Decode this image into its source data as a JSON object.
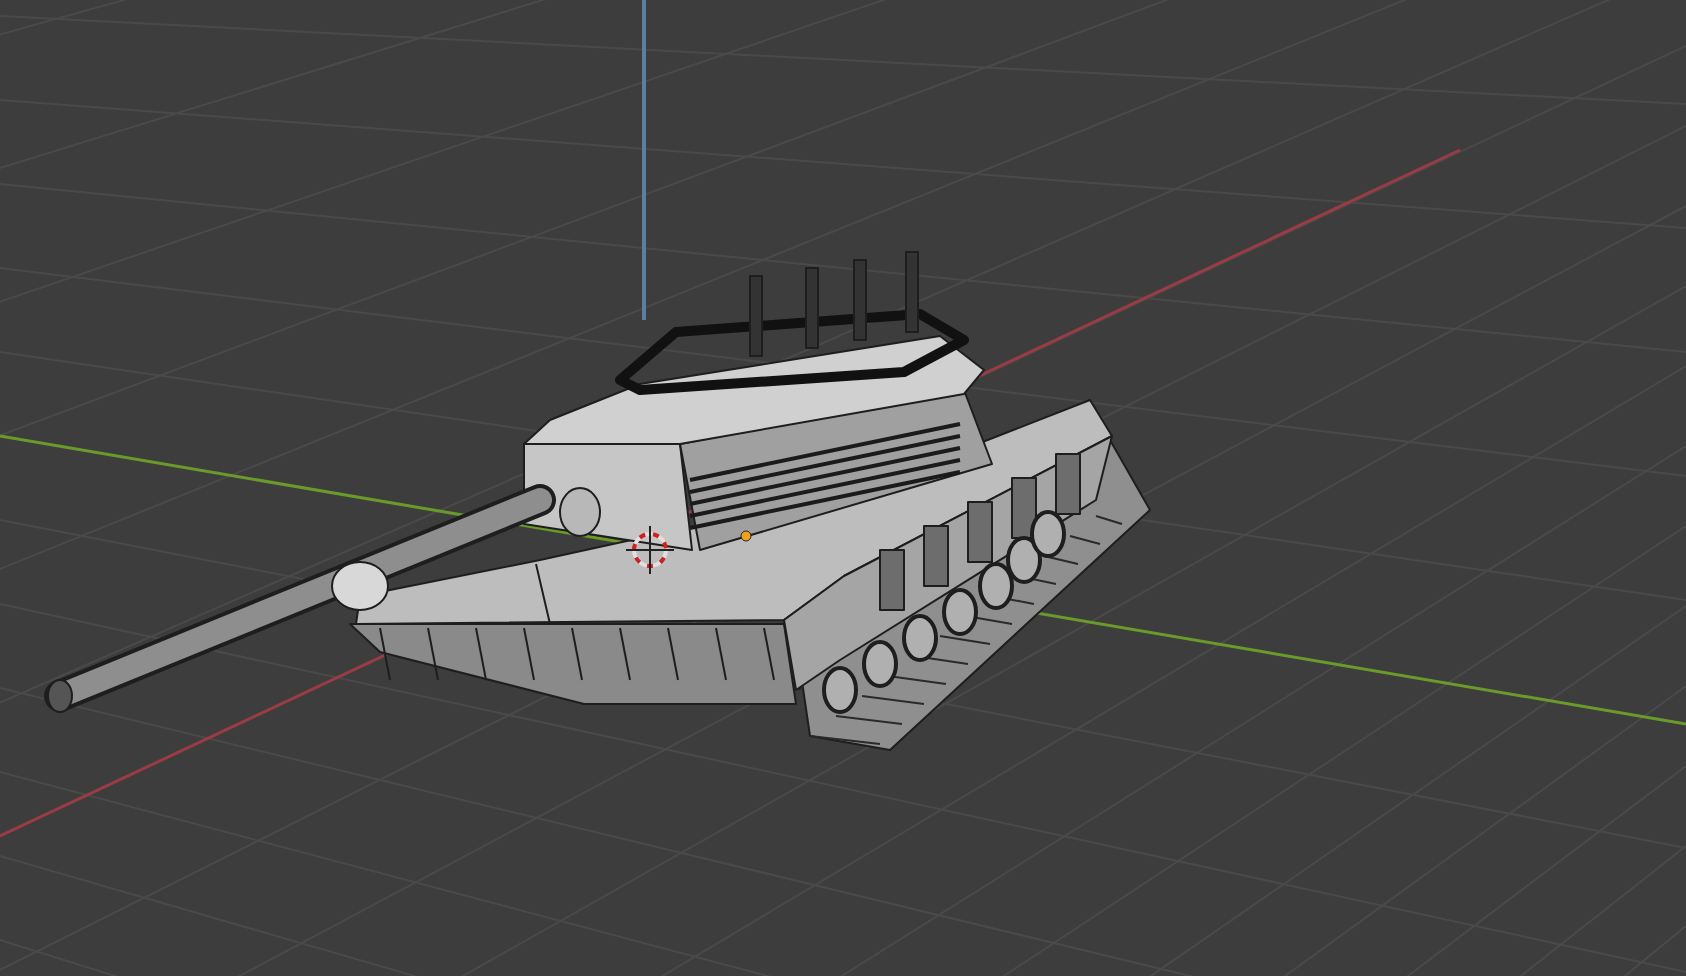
{
  "viewport": {
    "floor_grid": true,
    "axis_x": true,
    "axis_y": true,
    "axis_z": true,
    "cursor_3d": true,
    "object_origin": true,
    "object": {
      "kind": "tank"
    }
  }
}
